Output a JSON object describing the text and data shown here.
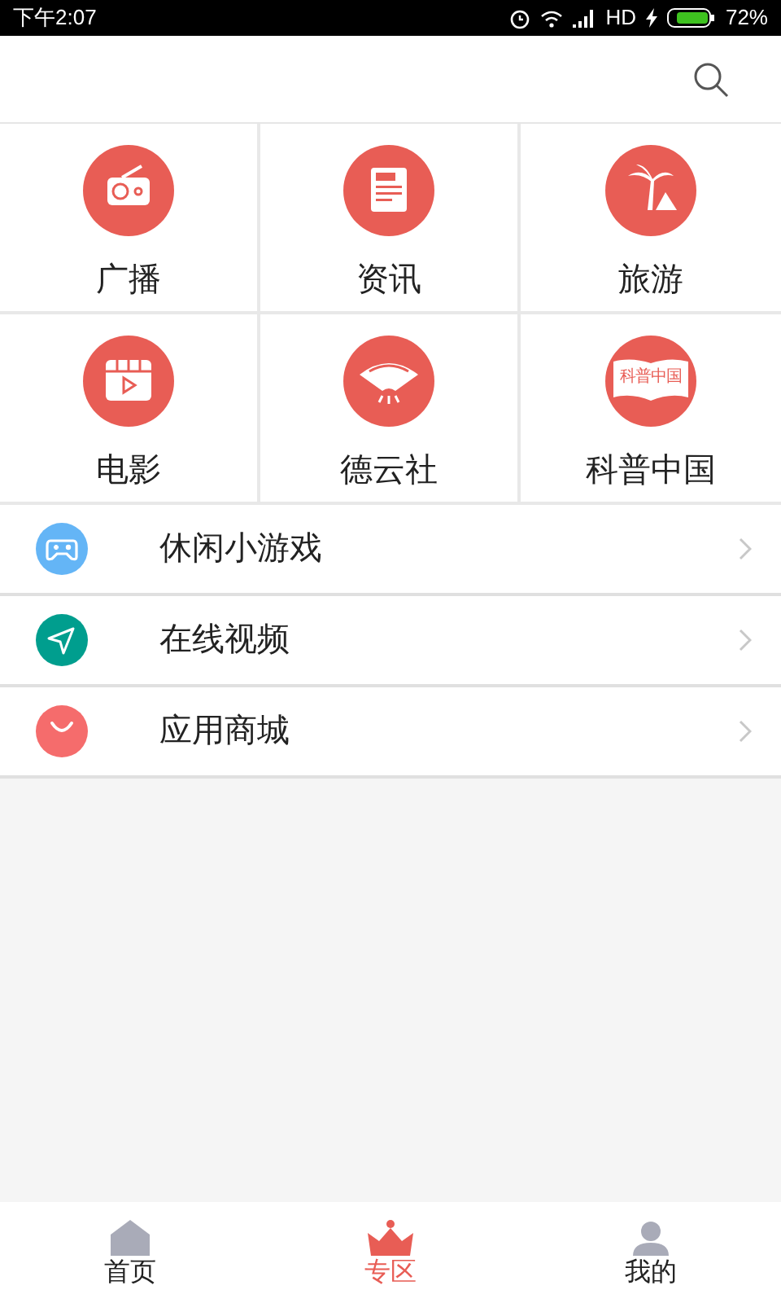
{
  "status_bar": {
    "time": "下午2:07",
    "network": "HD",
    "battery": "72%"
  },
  "grid": [
    {
      "label": "广播",
      "kind": "radio"
    },
    {
      "label": "资讯",
      "kind": "news"
    },
    {
      "label": "旅游",
      "kind": "travel"
    },
    {
      "label": "电影",
      "kind": "movie"
    },
    {
      "label": "德云社",
      "kind": "fan"
    },
    {
      "label": "科普中国",
      "kind": "book",
      "icon_text": "科普中国"
    }
  ],
  "list": [
    {
      "label": "休闲小游戏",
      "kind": "game",
      "color": "#64b5f6"
    },
    {
      "label": "在线视频",
      "kind": "send",
      "color": "#009e8e"
    },
    {
      "label": "应用商城",
      "kind": "shop",
      "color": "#f56c6c"
    }
  ],
  "tabs": [
    {
      "label": "首页",
      "kind": "home",
      "selected": false
    },
    {
      "label": "专区",
      "kind": "crown",
      "selected": true
    },
    {
      "label": "我的",
      "kind": "user",
      "selected": false
    }
  ]
}
